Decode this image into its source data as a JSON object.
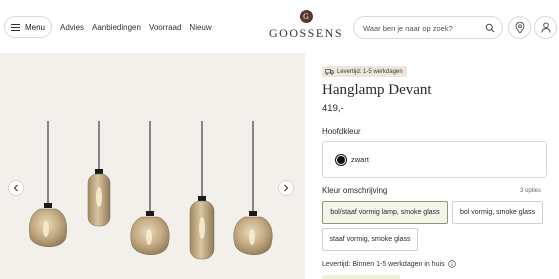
{
  "header": {
    "menu_label": "Menu",
    "nav": [
      "Advies",
      "Aanbiedingen",
      "Voorraad",
      "Nieuw"
    ],
    "logo_mark": "G",
    "logo_text": "GOOSSENS",
    "search_placeholder": "Waar ben je naar op zoek?",
    "icons": [
      "menu-icon",
      "search-icon",
      "location-pin-icon",
      "user-icon"
    ]
  },
  "gallery": {
    "image_description": "five glass pendant lamps",
    "prev_icon": "chevron-left-icon",
    "next_icon": "chevron-right-icon"
  },
  "product": {
    "badge": "Levertijd: 1-5 werkdagen",
    "badge_icon": "truck-icon",
    "title": "Hanglamp Devant",
    "price": "419,-"
  },
  "main_color": {
    "label": "Hoofdkleur",
    "selected": "zwart",
    "swatch_color": "#111111"
  },
  "variant": {
    "label": "Kleur omschrijving",
    "count": "3 opties",
    "options": [
      {
        "label": "bol/staaf vormig lamp, smoke glass",
        "selected": true
      },
      {
        "label": "bol vormig, smoke glass",
        "selected": false
      },
      {
        "label": "staaf vormig, smoke glass",
        "selected": false
      }
    ]
  },
  "delivery": {
    "text": "Levertijd: Binnen 1-5 werkdagen in huis",
    "info_icon": "info-icon"
  },
  "colors": {
    "accent_selected_border": "#8a9a68",
    "accent_selected_bg": "#f3f4ea",
    "gallery_bg": "#f3f0ec",
    "badge_bg": "#ece6dc"
  }
}
